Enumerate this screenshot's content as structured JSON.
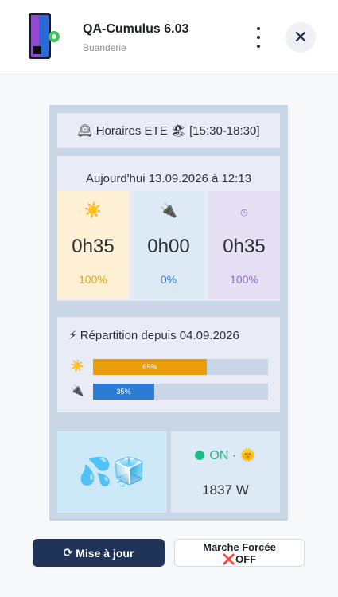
{
  "header": {
    "title": "QA-Cumulus 6.03",
    "subtitle": "Buanderie",
    "close_label": "✕"
  },
  "schedule": {
    "clock_icon": "🕰",
    "text": "Horaires ETE",
    "beach_icon": "🏖",
    "range": "[15:30-18:30]"
  },
  "today": {
    "label": "Aujourd'hui 13.09.2026 à 12:13",
    "stats": [
      {
        "icon": "☀️",
        "value": "0h35",
        "percent": "100%",
        "color": "#e6a500"
      },
      {
        "icon": "🔌",
        "value": "0h00",
        "percent": "0%",
        "color": "#2f7fd1"
      },
      {
        "icon": "◷",
        "value": "0h35",
        "percent": "100%",
        "color": "#8a6bd1"
      }
    ]
  },
  "repartition": {
    "icon": "⚡",
    "title": "Répartition depuis 04.09.2026",
    "bars": [
      {
        "icon": "☀️",
        "label": "65%",
        "fraction": 0.65,
        "color": "#e99d0c"
      },
      {
        "icon": "🔌",
        "label": "35%",
        "fraction": 0.35,
        "color": "#2c7cd3"
      }
    ]
  },
  "status": {
    "water_icons": "💦🧊",
    "state": "ON",
    "sep": "·",
    "sun_icon": "🌞",
    "power": "1837 W"
  },
  "actions": {
    "update_icon": "⟳",
    "update_label": "Mise à jour",
    "force_label": "Marche Forcée",
    "force_state_icon": "❌",
    "force_state": "OFF"
  }
}
